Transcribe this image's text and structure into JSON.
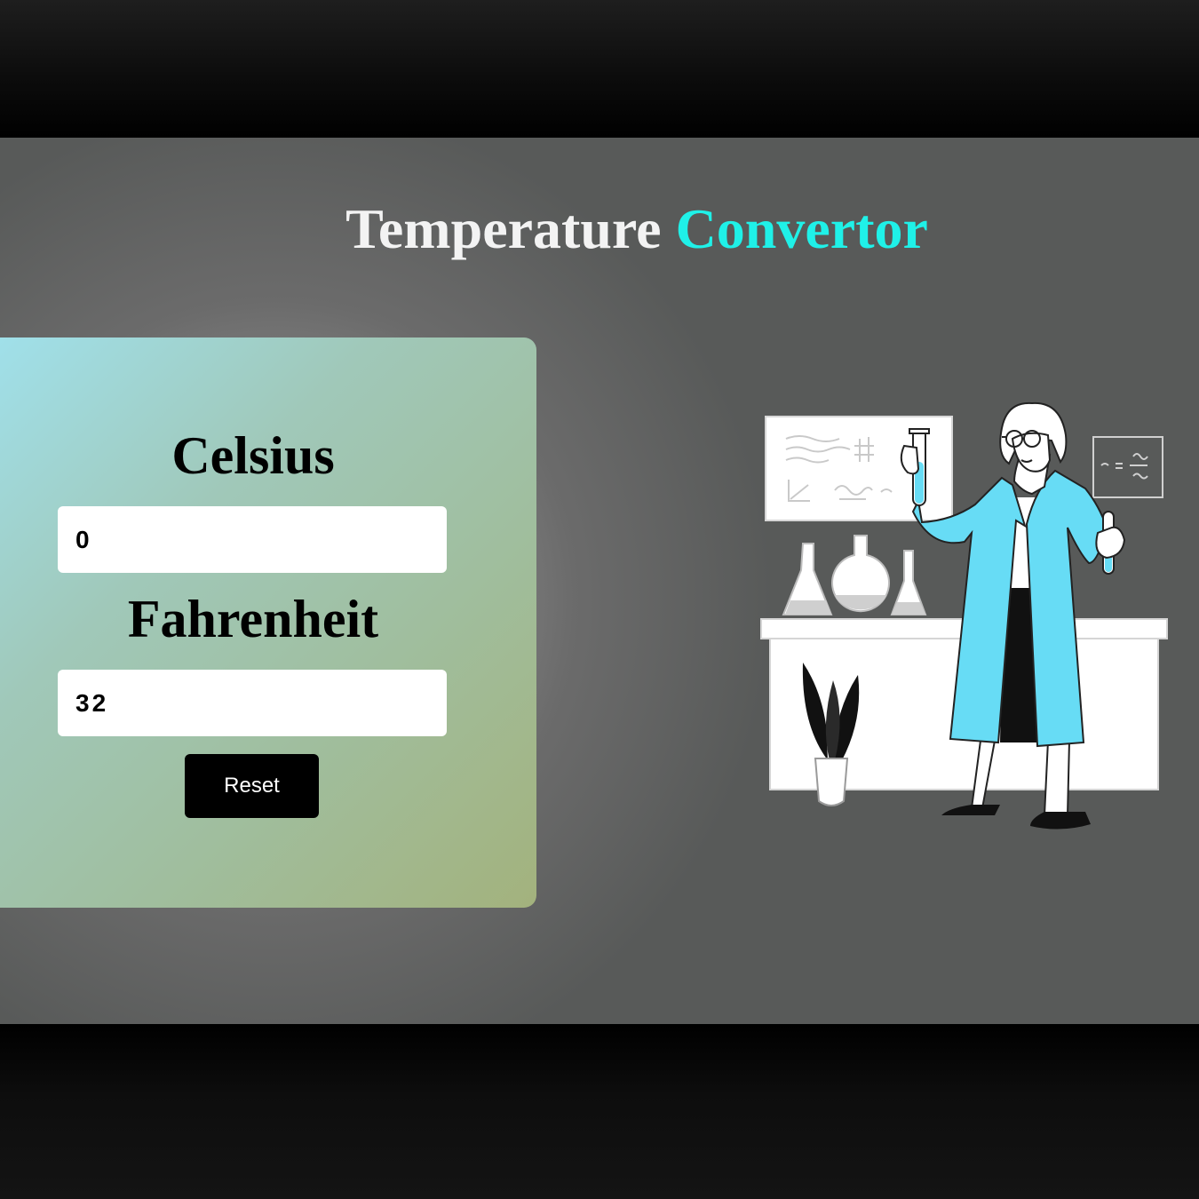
{
  "title": {
    "main": "Temperature",
    "accent": "Convertor"
  },
  "celsius": {
    "label": "Celsius",
    "value": "0"
  },
  "fahrenheit": {
    "label": "Fahrenheit",
    "value": "32"
  },
  "reset_label": "Reset",
  "colors": {
    "accent": "#1ff1e8",
    "coat": "#67dcf5",
    "button": "#000000"
  },
  "illustration": {
    "subject": "scientist-with-test-tubes",
    "board_icons": [
      "chart-board-icon",
      "formula-board-icon"
    ]
  }
}
